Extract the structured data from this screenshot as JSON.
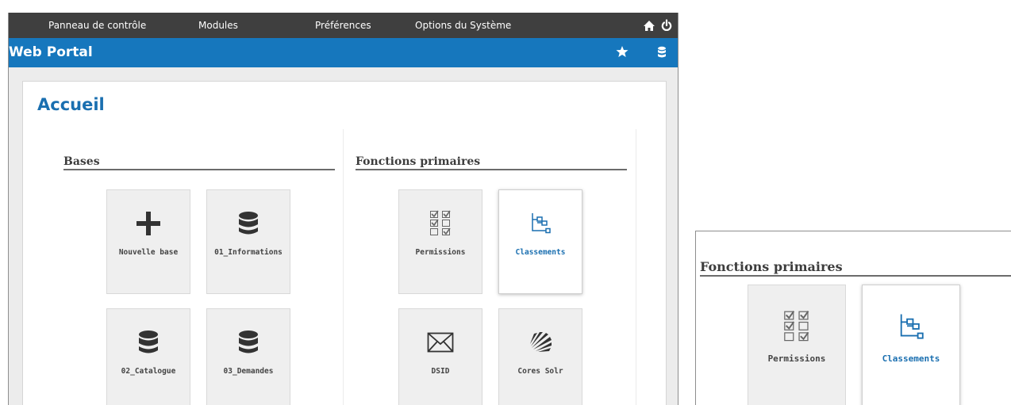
{
  "menu": {
    "items": [
      "Panneau de contrôle",
      "Modules",
      "Préférences",
      "Options du Système"
    ]
  },
  "header": {
    "title": "Web Portal"
  },
  "page": {
    "title": "Accueil"
  },
  "bases": {
    "heading": "Bases",
    "tiles": [
      "Nouvelle base",
      "01_Informations",
      "02_Catalogue",
      "03_Demandes"
    ]
  },
  "fonctions": {
    "heading": "Fonctions primaires",
    "tiles": [
      "Permissions",
      "Classements",
      "DSID",
      "Cores Solr"
    ]
  },
  "inset": {
    "heading": "Fonctions primaires",
    "tiles": [
      "Permissions",
      "Classements"
    ]
  },
  "icons": {
    "home": "home-icon",
    "power": "power-icon",
    "star": "star-icon",
    "database": "database-icon",
    "add": "plus-icon",
    "permissions": "checklist-icon",
    "classements": "hierarchy-icon",
    "dsid": "envelope-icon",
    "solr": "solr-icon"
  },
  "colors": {
    "topbar": "#3f3f3f",
    "titlebar": "#1677bd",
    "accent": "#1a6fb0",
    "tile_bg": "#efefef"
  }
}
